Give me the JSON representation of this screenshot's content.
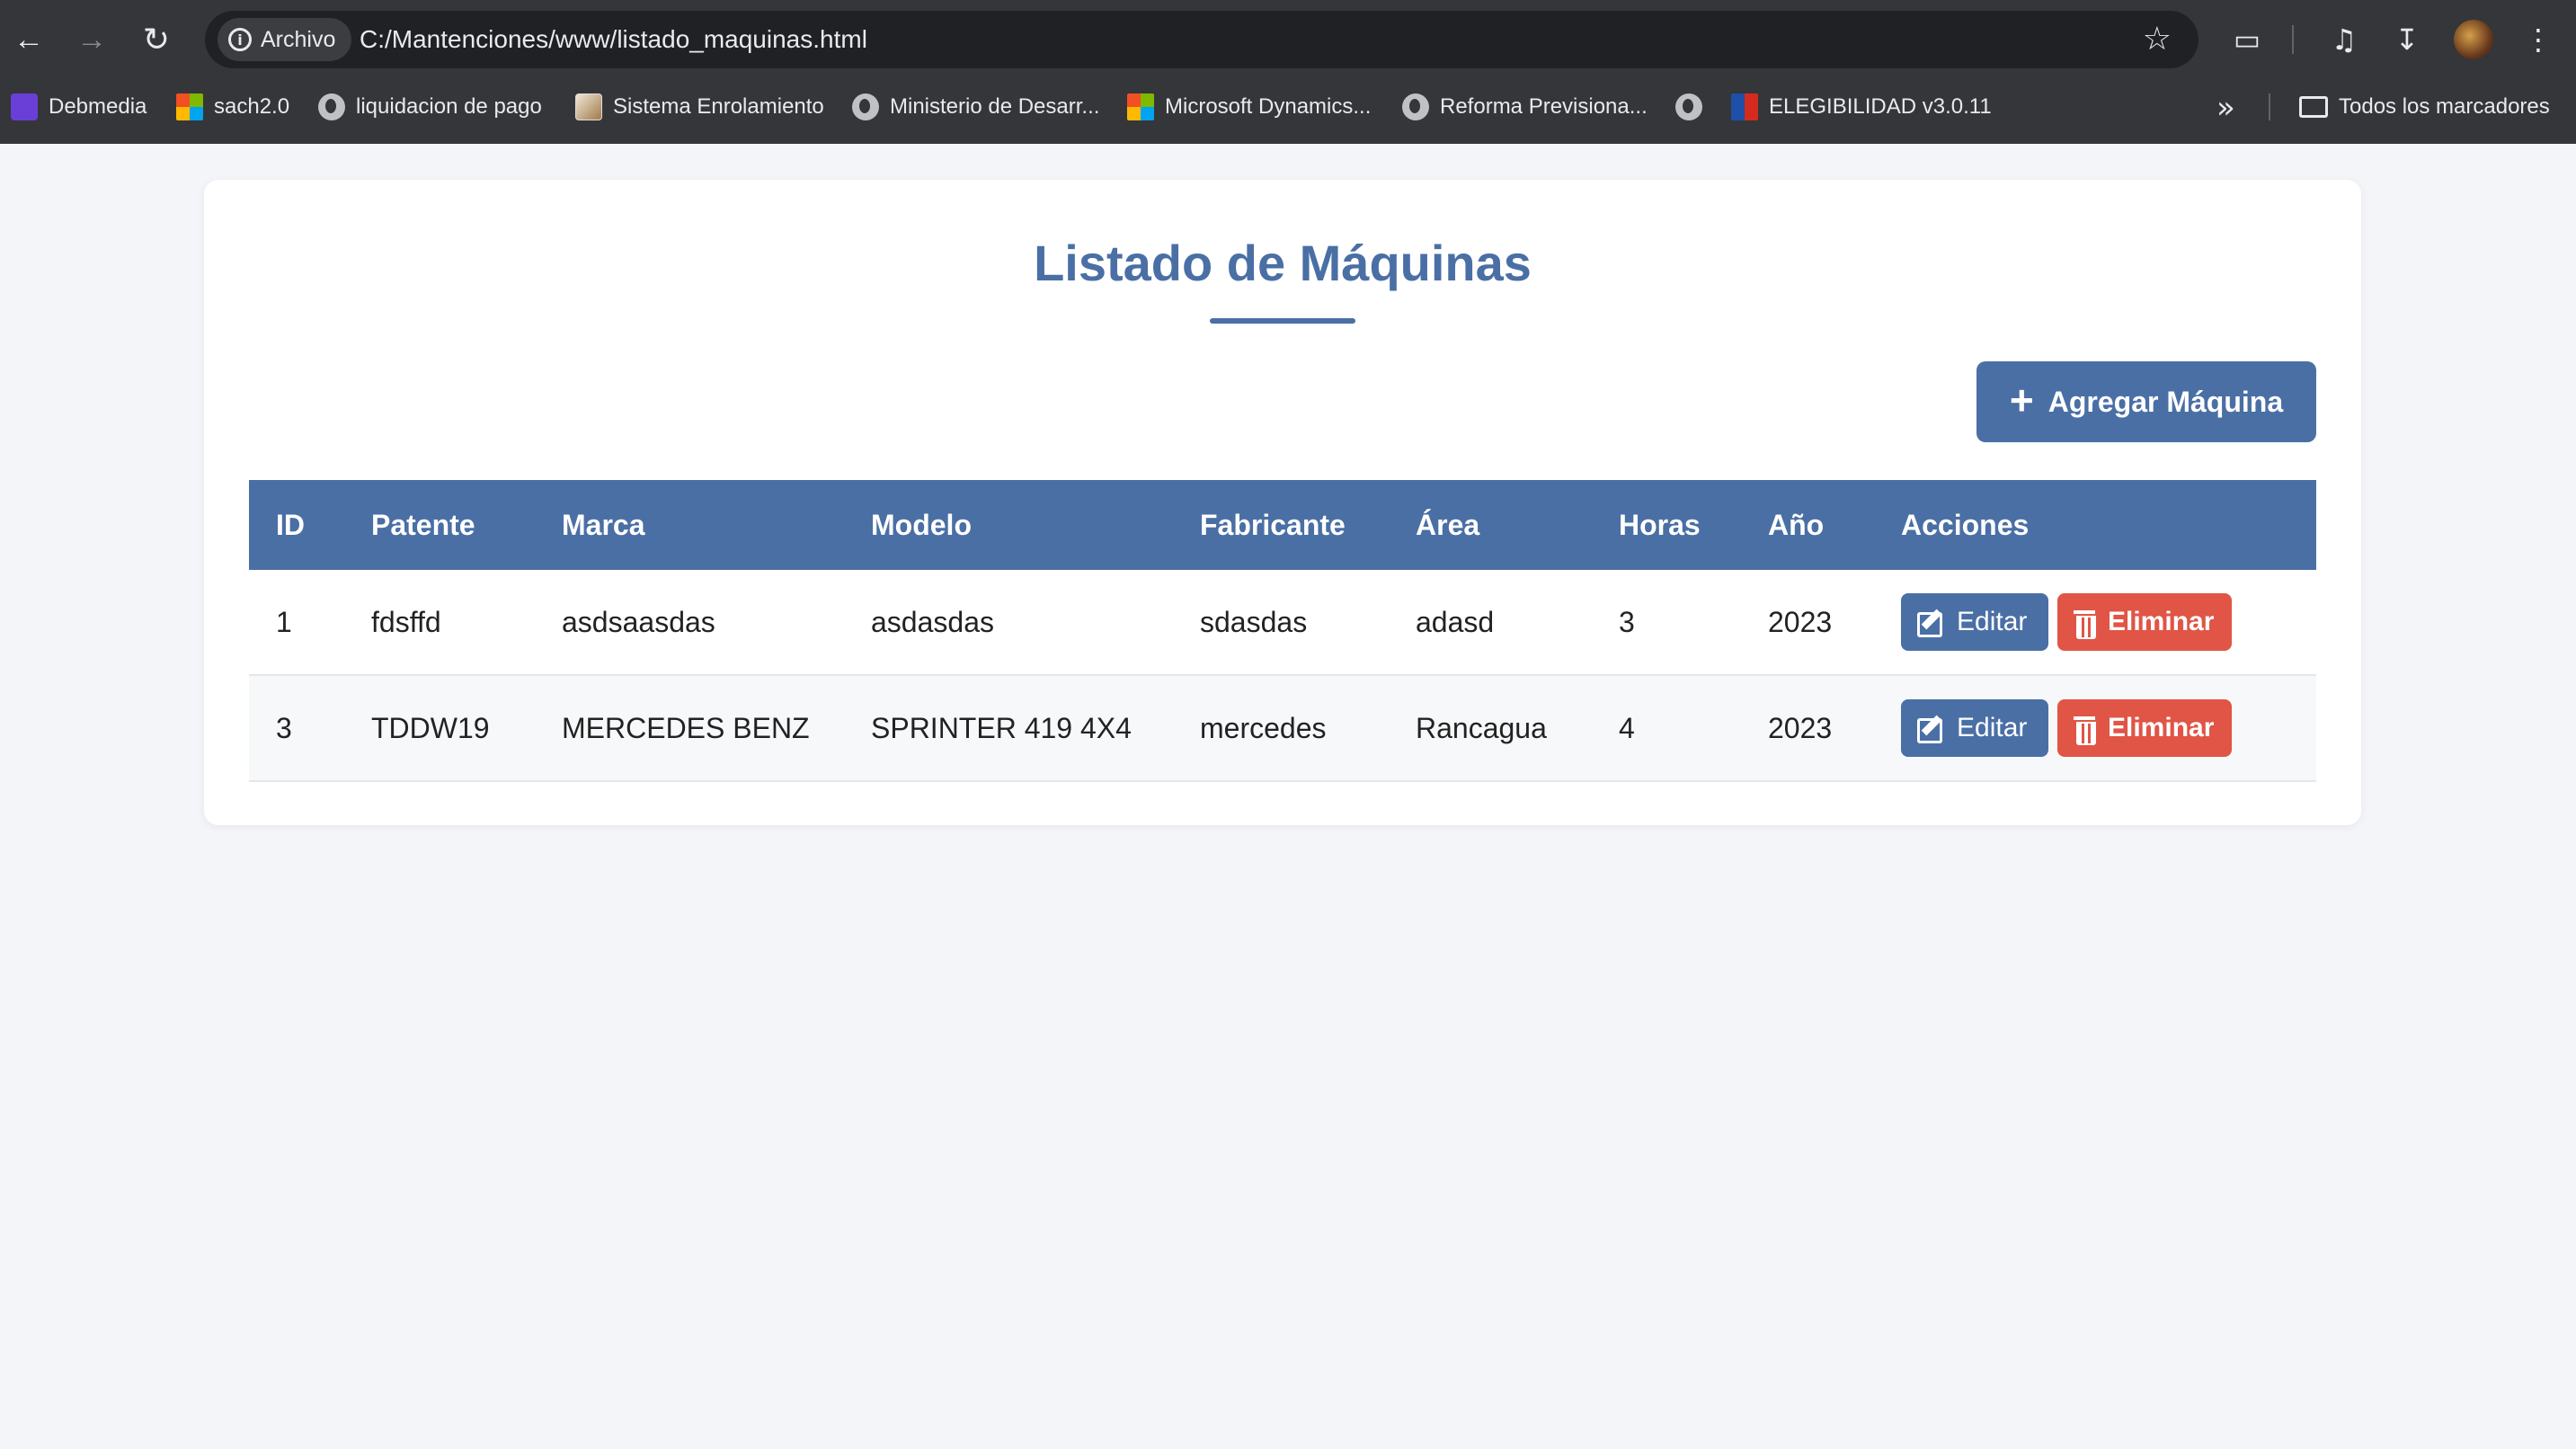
{
  "browser": {
    "chip_label": "Archivo",
    "url": "C:/Mantenciones/www/listado_maquinas.html",
    "bookmarks": [
      {
        "label": "Debmedia",
        "icon": "purple-app-icon"
      },
      {
        "label": "sach2.0",
        "icon": "microsoft-icon"
      },
      {
        "label": "liquidacion de pago",
        "icon": "globe-icon"
      },
      {
        "label": "Sistema Enrolamiento",
        "icon": "site-image-icon"
      },
      {
        "label": "Ministerio de Desarr...",
        "icon": "globe-icon"
      },
      {
        "label": "Microsoft Dynamics...",
        "icon": "microsoft-icon"
      },
      {
        "label": "Reforma Previsiona...",
        "icon": "globe-icon"
      },
      {
        "label": "",
        "icon": "globe-icon"
      },
      {
        "label": "ELEGIBILIDAD v3.0.11",
        "icon": "flag-icon"
      }
    ],
    "all_bookmarks_label": "Todos los marcadores"
  },
  "page": {
    "title": "Listado de Máquinas",
    "add_button_label": "Agregar Máquina",
    "accent_color": "#4a6fa5",
    "danger_color": "#e05546"
  },
  "table": {
    "columns": [
      "ID",
      "Patente",
      "Marca",
      "Modelo",
      "Fabricante",
      "Área",
      "Horas",
      "Año",
      "Acciones"
    ],
    "rows": [
      {
        "id": "1",
        "patente": "fdsffd",
        "marca": "asdsaasdas",
        "modelo": "asdasdas",
        "fabricante": "sdasdas",
        "area": "adasd",
        "horas": "3",
        "anio": "2023"
      },
      {
        "id": "3",
        "patente": "TDDW19",
        "marca": "MERCEDES BENZ",
        "modelo": "SPRINTER 419 4X4",
        "fabricante": "mercedes",
        "area": "Rancagua",
        "horas": "4",
        "anio": "2023"
      }
    ],
    "edit_label": "Editar",
    "delete_label": "Eliminar"
  }
}
